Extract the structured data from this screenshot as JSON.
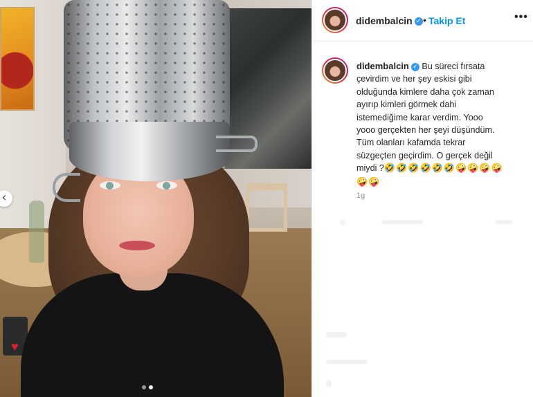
{
  "header": {
    "username": "didembalcin",
    "verified_icon": "verified-check-icon",
    "separator": "•",
    "follow_label": "Takip Et",
    "more_icon": "…"
  },
  "caption": {
    "username": "didembalcin",
    "lines": [
      "Bu süreci fırsata",
      "çevirdim ve her şey eskisi gibi",
      "olduğunda kimlere daha çok zaman",
      "ayırıp kimleri görmek dahi",
      "istemediğime karar verdim. Yooo",
      "yooo gerçekten her şeyi düşündüm.",
      "Tüm olanları kafamda tekrar",
      "süzgeçten geçirdim. O gerçek değil",
      "miydi ?"
    ],
    "emojis_line1": "🤣🤣🤣🤣🤣🤣🤪🤪🤪🤪",
    "emojis_line2": "🤪🤪"
  },
  "timestamp": "1g",
  "carousel": {
    "prev_icon": "‹",
    "dot_count": 2,
    "active_dot": 1
  },
  "colors": {
    "accent": "#0095f6",
    "text": "#262626",
    "muted": "#8e8e8e"
  }
}
